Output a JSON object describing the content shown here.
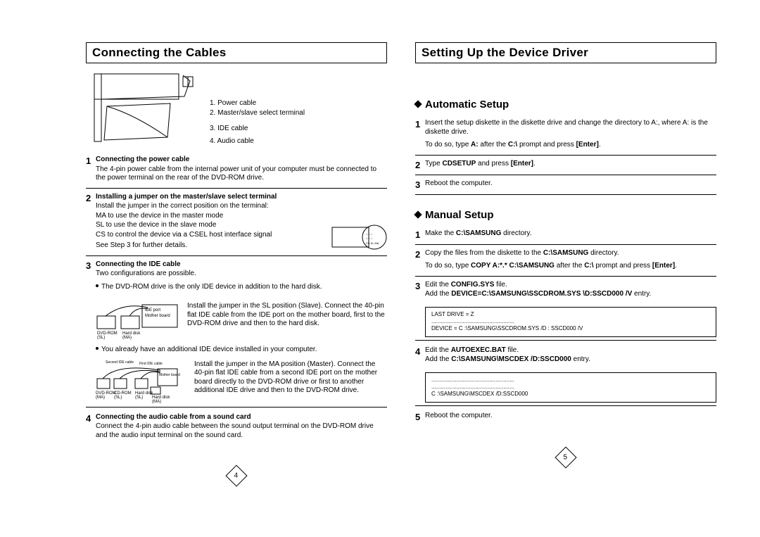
{
  "left": {
    "title": "Connecting the Cables",
    "callouts": [
      "1. Power cable",
      "2. Master/slave select terminal",
      "3. IDE cable",
      "4. Audio cable"
    ],
    "step1": {
      "title": "Connecting the power cable",
      "body": "The 4-pin power cable from the internal power unit of your computer must be connected to the power terminal on the rear of the DVD-ROM drive."
    },
    "step2": {
      "title": "Installing a jumper on the master/slave select terminal",
      "l1": "Install the jumper in the correct position on the terminal:",
      "l2": "MA to use the device in the master mode",
      "l3": "SL  to use the device in the slave mode",
      "l4": "CS to control the device via a CSEL host interface signal",
      "l5": "See Step 3 for further details."
    },
    "step3": {
      "title": "Connecting the IDE cable",
      "intro": "Two configurations are possible.",
      "bullet1": "The DVD-ROM drive is the only IDE device in addition to the hard disk.",
      "diag1": {
        "ide": "IDE port",
        "mb": "Mother board",
        "l1": "DVD-ROM",
        "l2": "(SL)",
        "l3": "Hard disk",
        "l4": "(MA)",
        "text": "Install the jumper in the SL position (Slave). Connect the 40-pin flat IDE cable from the IDE port on the mother board, first to the DVD-ROM drive and then to the hard disk."
      },
      "bullet2": "You already have an additional IDE device installed in your computer.",
      "diag2": {
        "second": "Second IDE cable",
        "first": "First IDE cable",
        "mb": "Mother board",
        "l1": "DVD-ROM",
        "l1b": "(MA)",
        "l2": "CD-ROM",
        "l2b": "(SL)",
        "l3": "Hard disk",
        "l3b": "(SL)",
        "l4": "Hard disk",
        "l4b": "(MA)",
        "text": "Install the jumper in the MA position (Master). Connect the 40-pin flat IDE cable from a second IDE port on the mother board directly to the DVD-ROM drive or first to another additional IDE drive and then to the DVD-ROM drive."
      }
    },
    "step4": {
      "title": "Connecting the audio cable from a sound card",
      "body": "Connect the 4-pin audio cable between the sound output terminal on the DVD-ROM drive and the audio input terminal on the sound card."
    },
    "pagenum": "4"
  },
  "right": {
    "title": "Setting Up the Device Driver",
    "auto": {
      "heading": "Automatic Setup",
      "s1a": "Insert the setup diskette in the diskette drive and change the directory to A:, where A: is the diskette drive.",
      "s1b_pre": "To do so, type ",
      "s1b_b1": "A:",
      "s1b_mid": " after the ",
      "s1b_b2": "C:\\",
      "s1b_mid2": " prompt and press ",
      "s1b_b3": "[Enter]",
      "s1b_end": ".",
      "s2_pre": "Type ",
      "s2_b": "CDSETUP",
      "s2_mid": " and press ",
      "s2_b2": "[Enter]",
      "s2_end": ".",
      "s3": "Reboot the computer."
    },
    "manual": {
      "heading": "Manual Setup",
      "s1_pre": "Make the ",
      "s1_b": "C:\\SAMSUNG",
      "s1_end": " directory.",
      "s2a_pre": "Copy the files from the diskette to the ",
      "s2a_b": "C:\\SAMSUNG",
      "s2a_end": " directory.",
      "s2b_pre": "To do so, type ",
      "s2b_b1": "COPY A:*.* C:\\SAMSUNG",
      "s2b_mid": " after the ",
      "s2b_b2": "C:\\",
      "s2b_mid2": " prompt and press ",
      "s2b_b3": "[Enter]",
      "s2b_end": ".",
      "s3_pre": "Edit the ",
      "s3_b": "CONFIG.SYS",
      "s3_end": " file.",
      "s3l2_pre": "Add the ",
      "s3l2_b": "DEVICE=C:\\SAMSUNG\\SSCDROM.SYS \\D:SSCD000 /V",
      "s3l2_end": " entry.",
      "code1_l1": "LAST DRIVE = Z",
      "code1_l2": ".....................................................",
      "code1_l3": "DEVICE = C :\\SAMSUNG\\SSCDROM.SYS /D : SSCD000 /V",
      "s4_pre": "Edit the ",
      "s4_b": "AUTOEXEC.BAT",
      "s4_end": " file.",
      "s4l2_pre": "Add the ",
      "s4l2_b": "C:\\SAMSUNG\\MSCDEX /D:SSCD000",
      "s4l2_end": " entry.",
      "code2_l1": ".....................................................",
      "code2_l2": ".....................................................",
      "code2_l3": "C :\\SAMSUNG\\MSCDEX /D:SSCD000",
      "s5": "Reboot the computer."
    },
    "pagenum": "5"
  }
}
